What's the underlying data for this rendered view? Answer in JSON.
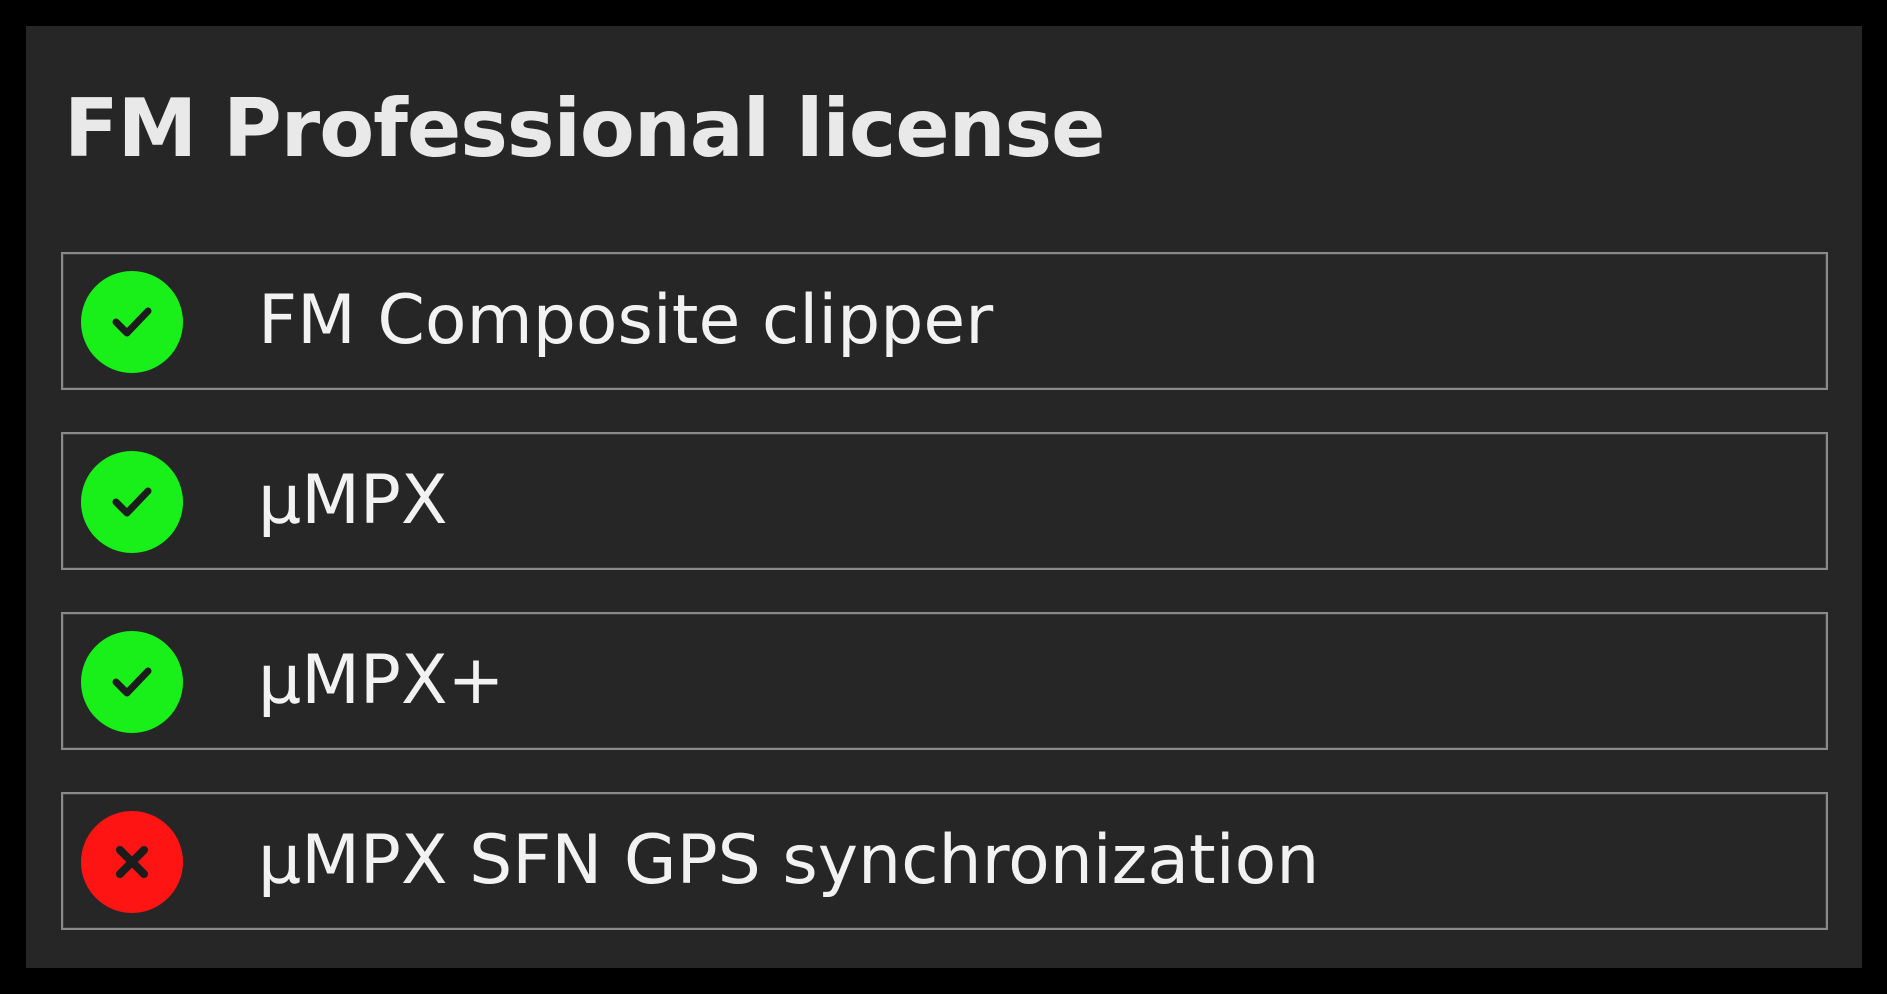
{
  "title": "FM Professional license",
  "colors": {
    "enabled": "#19f019",
    "disabled": "#ff1414",
    "mark": "#1c1c1c"
  },
  "features": [
    {
      "label": "FM Composite clipper",
      "status": "enabled",
      "icon": "check-icon"
    },
    {
      "label": "µMPX",
      "status": "enabled",
      "icon": "check-icon"
    },
    {
      "label": "µMPX+",
      "status": "enabled",
      "icon": "check-icon"
    },
    {
      "label": "µMPX SFN GPS synchronization",
      "status": "disabled",
      "icon": "cross-icon"
    }
  ]
}
